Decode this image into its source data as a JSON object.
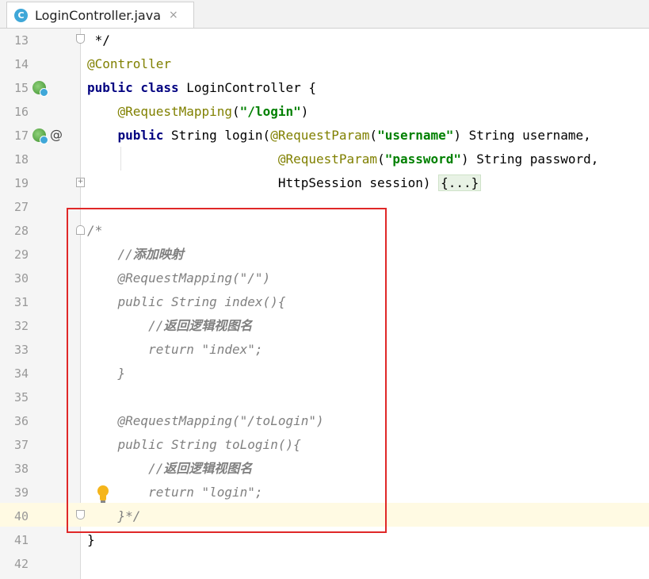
{
  "tab": {
    "icon_letter": "C",
    "file_name": "LoginController.java",
    "close_glyph": "×"
  },
  "colors": {
    "keyword": "#000080",
    "annotation": "#808000",
    "string": "#008000",
    "comment": "#808080",
    "highlight_box": "#e02828",
    "current_line": "#fffae3"
  },
  "gutter_icons": {
    "line15": "spring-bean-icon",
    "line17_a": "spring-request-mapping-icon",
    "line17_b": "@",
    "line39": "lightbulb-icon"
  },
  "lines": [
    {
      "num": "13",
      "tokens": [
        {
          "t": " */",
          "c": "cm-plain"
        }
      ]
    },
    {
      "num": "14",
      "tokens": [
        {
          "t": "@Controller",
          "c": "ann"
        }
      ]
    },
    {
      "num": "15",
      "tokens": [
        {
          "t": "public class",
          "c": "kw"
        },
        {
          "t": " LoginController {",
          "c": ""
        }
      ]
    },
    {
      "num": "16",
      "tokens": [
        {
          "t": "    ",
          "c": ""
        },
        {
          "t": "@RequestMapping",
          "c": "ann"
        },
        {
          "t": "(",
          "c": ""
        },
        {
          "t": "\"/login\"",
          "c": "str"
        },
        {
          "t": ")",
          "c": ""
        }
      ]
    },
    {
      "num": "17",
      "tokens": [
        {
          "t": "    ",
          "c": ""
        },
        {
          "t": "public",
          "c": "kw"
        },
        {
          "t": " String login(",
          "c": ""
        },
        {
          "t": "@RequestParam",
          "c": "ann"
        },
        {
          "t": "(",
          "c": ""
        },
        {
          "t": "\"username\"",
          "c": "str"
        },
        {
          "t": ") String username,",
          "c": ""
        }
      ]
    },
    {
      "num": "18",
      "tokens": [
        {
          "t": "                         ",
          "c": ""
        },
        {
          "t": "@RequestParam",
          "c": "ann"
        },
        {
          "t": "(",
          "c": ""
        },
        {
          "t": "\"password\"",
          "c": "str"
        },
        {
          "t": ") String password,",
          "c": ""
        }
      ]
    },
    {
      "num": "19",
      "tokens": [
        {
          "t": "                         HttpSession session) ",
          "c": ""
        },
        {
          "t": "{...}",
          "c": "fold-ph"
        }
      ]
    },
    {
      "num": "27",
      "tokens": []
    },
    {
      "num": "28",
      "tokens": [
        {
          "t": "/*",
          "c": "cm"
        }
      ]
    },
    {
      "num": "29",
      "tokens": [
        {
          "t": "    //",
          "c": "cm"
        },
        {
          "t": "添加映射",
          "c": "cm-cn"
        }
      ]
    },
    {
      "num": "30",
      "tokens": [
        {
          "t": "    @RequestMapping(\"/\")",
          "c": "cm"
        }
      ]
    },
    {
      "num": "31",
      "tokens": [
        {
          "t": "    public String index(){",
          "c": "cm"
        }
      ]
    },
    {
      "num": "32",
      "tokens": [
        {
          "t": "        //",
          "c": "cm"
        },
        {
          "t": "返回逻辑视图名",
          "c": "cm-cn"
        }
      ]
    },
    {
      "num": "33",
      "tokens": [
        {
          "t": "        return \"index\";",
          "c": "cm"
        }
      ]
    },
    {
      "num": "34",
      "tokens": [
        {
          "t": "    }",
          "c": "cm"
        }
      ]
    },
    {
      "num": "35",
      "tokens": []
    },
    {
      "num": "36",
      "tokens": [
        {
          "t": "    @RequestMapping(\"/toLogin\")",
          "c": "cm"
        }
      ]
    },
    {
      "num": "37",
      "tokens": [
        {
          "t": "    public String toLogin(){",
          "c": "cm"
        }
      ]
    },
    {
      "num": "38",
      "tokens": [
        {
          "t": "        //",
          "c": "cm"
        },
        {
          "t": "返回逻辑视图名",
          "c": "cm-cn"
        }
      ]
    },
    {
      "num": "39",
      "tokens": [
        {
          "t": "        return \"login\";",
          "c": "cm"
        }
      ]
    },
    {
      "num": "40",
      "tokens": [
        {
          "t": "    }*/",
          "c": "cm"
        }
      ]
    },
    {
      "num": "41",
      "tokens": [
        {
          "t": "}",
          "c": ""
        }
      ]
    },
    {
      "num": "42",
      "tokens": []
    }
  ]
}
